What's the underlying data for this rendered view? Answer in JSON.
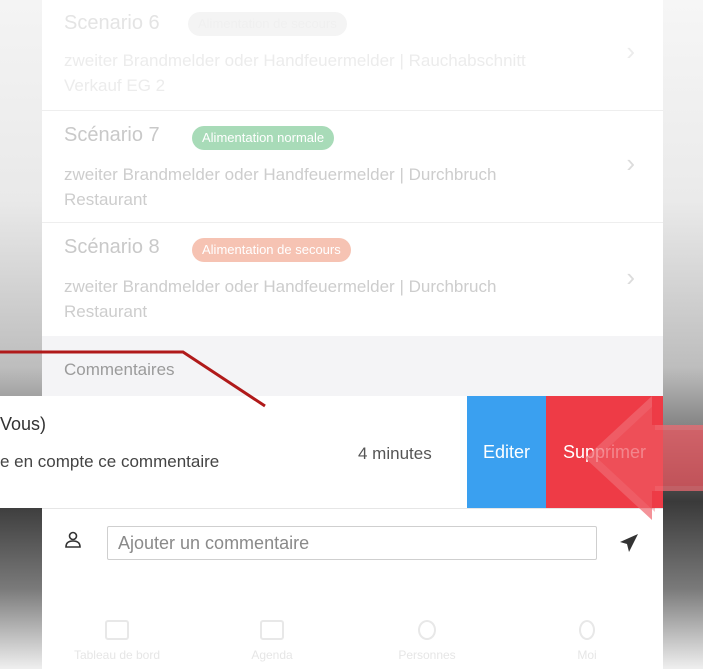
{
  "scenarios": [
    {
      "title": "Scenario 6",
      "badge": "Alimentation de secours",
      "desc": "zweiter Brandmelder oder Handfeuermelder | Rauchabschnitt Verkauf EG 2"
    },
    {
      "title": "Scénario 7",
      "badge": "Alimentation normale",
      "desc": "zweiter Brandmelder oder Handfeuermelder | Durchbruch Restaurant"
    },
    {
      "title": "Scénario 8",
      "badge": "Alimentation de secours",
      "desc": "zweiter Brandmelder oder Handfeuermelder | Durchbruch Restaurant"
    }
  ],
  "comments": {
    "header": "Commentaires",
    "item": {
      "author": "Vous)",
      "text": "e en compte ce commentaire",
      "time": "4 minutes",
      "edit_label": "Editer",
      "delete_label": "Supprimer"
    },
    "input_placeholder": "Ajouter un commentaire"
  },
  "tabs": [
    {
      "label": "Tableau de bord",
      "icon": "dashboard-icon"
    },
    {
      "label": "Agenda",
      "icon": "calendar-icon"
    },
    {
      "label": "Personnes",
      "icon": "people-icon"
    },
    {
      "label": "Moi",
      "icon": "user-icon"
    }
  ],
  "colors": {
    "badge_green": "#a8dbb8",
    "badge_orange": "#f6c3b3",
    "edit_blue": "#3aa0f0",
    "delete_red": "#ee3b46",
    "arrow_red": "#ee3b46",
    "annotation_line": "#b01a1a"
  }
}
